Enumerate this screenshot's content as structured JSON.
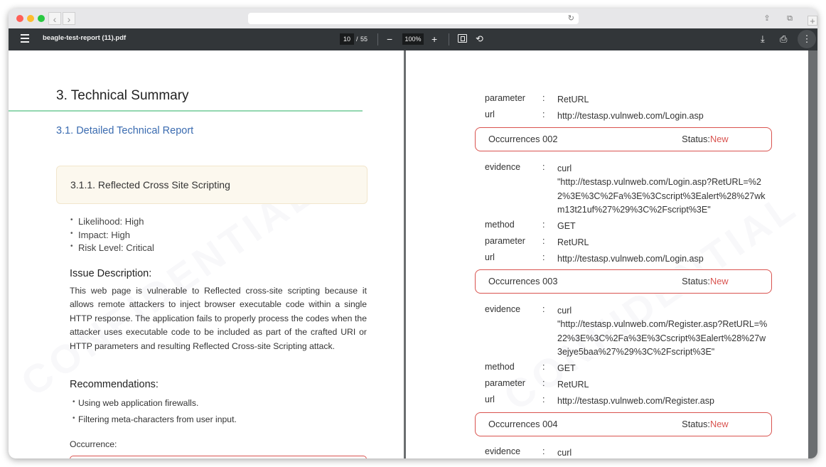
{
  "browser": {
    "colors": {
      "close": "#ff5f57",
      "minimize": "#febc2e",
      "maximize": "#28c840"
    },
    "back_glyph": "‹",
    "forward_glyph": "›",
    "reload_glyph": "↻",
    "share_glyph": "⇪",
    "tabs_glyph": "⧉",
    "new_tab_glyph": "+"
  },
  "pdf_toolbar": {
    "file_name": "beagle-test-report (11).pdf",
    "current_page": "10",
    "page_separator": "/",
    "total_pages": "55",
    "zoom_out_glyph": "−",
    "zoom": "100%",
    "zoom_in_glyph": "+",
    "rotate_glyph": "⟲",
    "download_glyph": "⤓",
    "print_glyph": "⎙",
    "more_glyph": "⋮"
  },
  "left_page": {
    "heading": "3. Technical Summary",
    "subheading": "3.1. Detailed Technical Report",
    "finding_title": "3.1.1. Reflected Cross Site Scripting",
    "ratings": [
      "Likelihood: High",
      "Impact: High",
      "Risk Level:  Critical"
    ],
    "issue_heading": "Issue Description:",
    "issue_text": "This web page is vulnerable to Reflected cross-site scripting because it allows remote attackers to inject browser executable code within a single HTTP response. The application fails to properly process the codes when the attacker uses executable code to be included as part of the crafted URI or HTTP parameters and resulting Reflected Cross-site Scripting attack.",
    "reco_heading": "Recommendations:",
    "recommendations": [
      "Using web application firewalls.",
      "Filtering meta-characters from user input."
    ],
    "occurrence_label": "Occurrence:"
  },
  "right_page": {
    "colon": ":",
    "status_label": "Status:",
    "top_rows": [
      {
        "key": "parameter",
        "value": "RetURL"
      },
      {
        "key": "url",
        "value": "http://testasp.vulnweb.com/Login.asp"
      }
    ],
    "occurrences": [
      {
        "title": "Occurrences 002",
        "status": "New",
        "rows": [
          {
            "key": "evidence",
            "value": "curl"
          },
          {
            "key": "",
            "value": "\"http://testasp.vulnweb.com/Login.asp?RetURL=%22%3E%3C%2Fa%3E%3Cscript%3Ealert%28%27wkm13t21uf%27%29%3C%2Fscript%3E\""
          },
          {
            "key": "method",
            "value": "GET"
          },
          {
            "key": "parameter",
            "value": "RetURL"
          },
          {
            "key": "url",
            "value": "http://testasp.vulnweb.com/Login.asp"
          }
        ]
      },
      {
        "title": "Occurrences 003",
        "status": "New",
        "rows": [
          {
            "key": "evidence",
            "value": "curl"
          },
          {
            "key": "",
            "value": "\"http://testasp.vulnweb.com/Register.asp?RetURL=%22%3E%3C%2Fa%3E%3Cscript%3Ealert%28%27w3ejye5baa%27%29%3C%2Fscript%3E\""
          },
          {
            "key": "method",
            "value": "GET"
          },
          {
            "key": "parameter",
            "value": "RetURL"
          },
          {
            "key": "url",
            "value": "http://testasp.vulnweb.com/Register.asp"
          }
        ]
      },
      {
        "title": "Occurrences 004",
        "status": "New",
        "rows": [
          {
            "key": "evidence",
            "value": "curl"
          }
        ]
      }
    ]
  },
  "watermark_text": "CONFIDENTIAL"
}
